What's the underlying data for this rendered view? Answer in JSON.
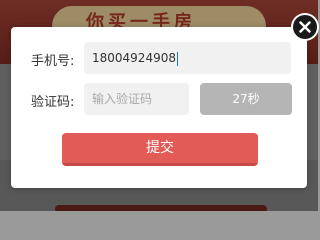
{
  "background": {
    "banner_text": "你买一手房"
  },
  "form": {
    "phone_label": "手机号:",
    "phone_value": "18004924908",
    "code_label": "验证码:",
    "code_placeholder": "输入验证码",
    "code_value": "",
    "countdown_label": "27秒",
    "submit_label": "提交"
  },
  "icons": {
    "close": "close-icon"
  },
  "colors": {
    "submit": "#e25b57",
    "countdown": "#b5b5b5",
    "input_bg": "#f1f1f1",
    "close_bg": "#1a1a1a"
  }
}
